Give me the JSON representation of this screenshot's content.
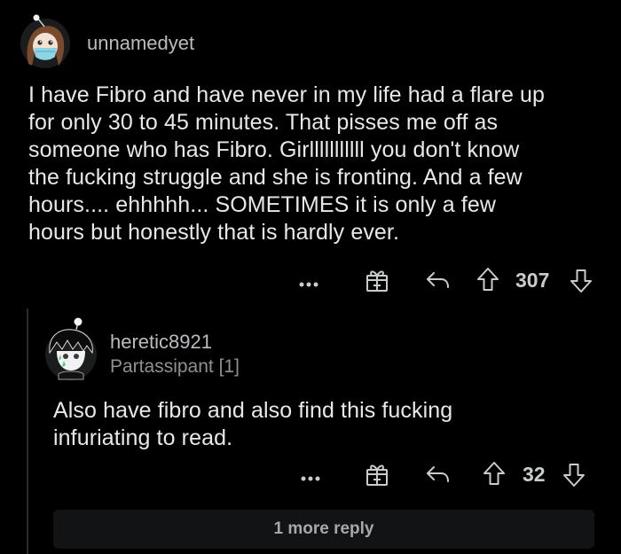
{
  "comment": {
    "username": "unnamedyet",
    "body": [
      "I have Fibro and have never in my life had a flare up",
      "for only 30 to 45 minutes. That pisses me off as",
      "someone who has Fibro. Girlllllllllll you don't know",
      "the fucking struggle and she is fronting. And a few",
      "hours.... ehhhhh... SOMETIMES it is only a few",
      "hours but honestly that is hardly ever."
    ],
    "votes": "307",
    "icons": {
      "more": "more-options-icon",
      "award": "gift-award-icon",
      "reply": "reply-arrow-icon",
      "upvote": "upvote-arrow-icon",
      "downvote": "downvote-arrow-icon"
    }
  },
  "reply": {
    "username": "heretic8921",
    "flair": "Partassipant [1]",
    "body": [
      "Also have fibro and also find this fucking",
      "infuriating to read."
    ],
    "votes": "32"
  },
  "more_replies_label": "1 more reply",
  "colors": {
    "background": "#000000",
    "text": "#e6e8e9",
    "muted": "#8e9193",
    "icon": "#c9cccd"
  }
}
